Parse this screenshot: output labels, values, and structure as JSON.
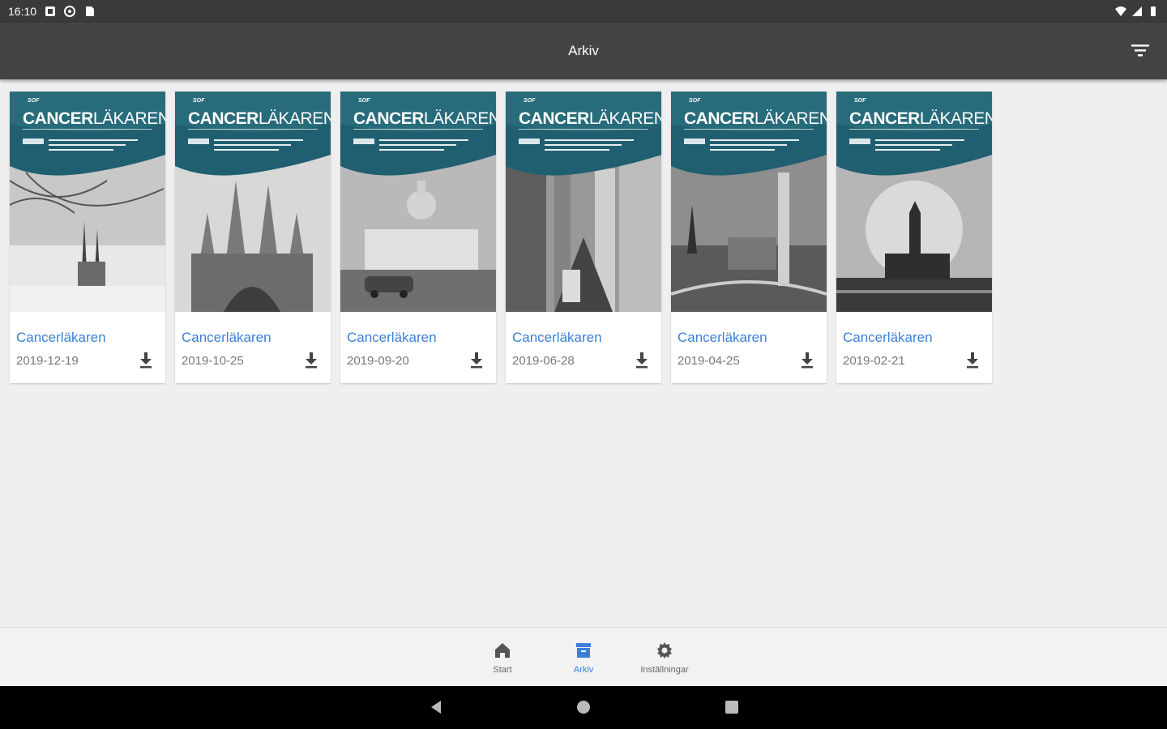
{
  "status": {
    "time": "16:10"
  },
  "appbar": {
    "title": "Arkiv"
  },
  "cover": {
    "brand_bold": "CANCER",
    "brand_thin": "LÄKAREN",
    "tag": "SOF"
  },
  "issues": [
    {
      "title": "Cancerläkaren",
      "date": "2019-12-19"
    },
    {
      "title": "Cancerläkaren",
      "date": "2019-10-25"
    },
    {
      "title": "Cancerläkaren",
      "date": "2019-09-20"
    },
    {
      "title": "Cancerläkaren",
      "date": "2019-06-28"
    },
    {
      "title": "Cancerläkaren",
      "date": "2019-04-25"
    },
    {
      "title": "Cancerläkaren",
      "date": "2019-02-21"
    }
  ],
  "nav": [
    {
      "label": "Start",
      "icon": "home-icon"
    },
    {
      "label": "Arkiv",
      "icon": "archive-icon",
      "active": true
    },
    {
      "label": "Inställningar",
      "icon": "gear-icon"
    }
  ],
  "colors": {
    "accent": "#3b7fd9",
    "appbar": "#444444",
    "cover_teal": "#1f5f6f"
  }
}
